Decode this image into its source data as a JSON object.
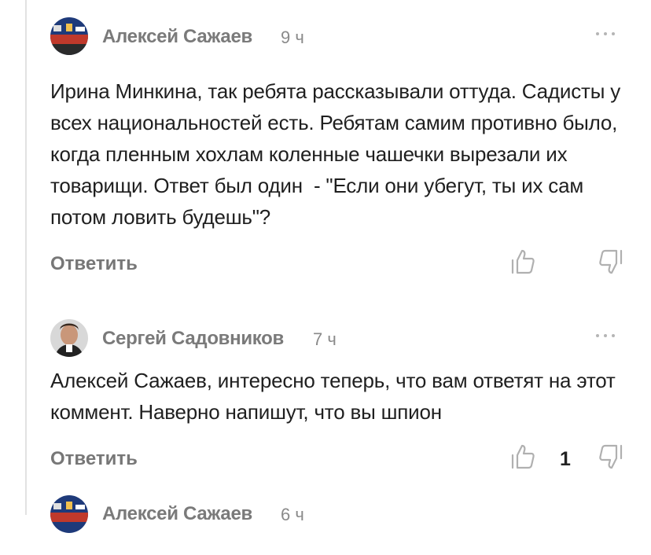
{
  "comments": [
    {
      "author": "Алексей Сажаев",
      "time": "9 ч",
      "text": "Ирина Минкина, так ребята рассказывали оттуда. Садисты у всех национальностей есть. Ребятам самим противно было, когда пленным хохлам коленные чашечки вырезали их товарищи. Ответ был один  - \"Если они убегут, ты их сам потом ловить будешь\"?",
      "reply_label": "Ответить",
      "likes": ""
    },
    {
      "author": "Сергей Садовников",
      "time": "7 ч",
      "text": "Алексей Сажаев, интересно теперь, что вам ответят на этот коммент. Наверно напишут, что вы шпион",
      "reply_label": "Ответить",
      "likes": "1"
    },
    {
      "author": "Алексей Сажаев",
      "time": "6 ч"
    }
  ],
  "icons": {
    "like": "thumbs-up-icon",
    "dislike": "thumbs-down-icon",
    "more": "more-dots-icon"
  },
  "colors": {
    "text": "#1f1f1f",
    "muted": "#7a7a7a",
    "icon": "#b0b0b0"
  }
}
